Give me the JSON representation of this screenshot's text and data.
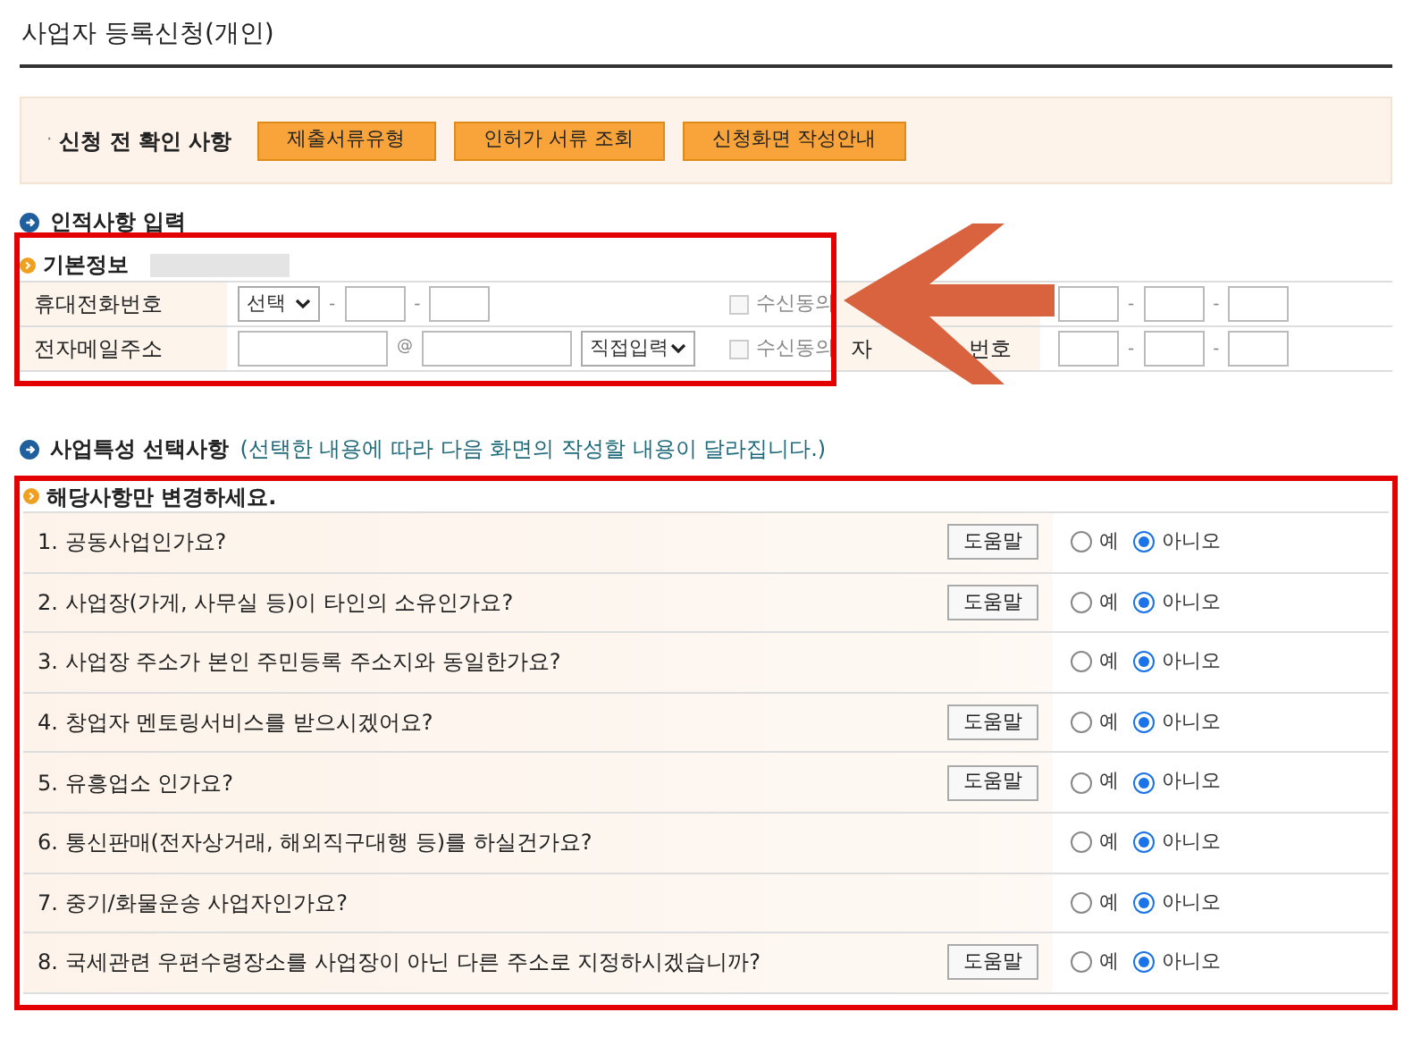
{
  "page_title": "사업자 등록신청(개인)",
  "pre_check": {
    "bullet": "·",
    "label": "신청 전 확인 사항",
    "buttons": [
      "제출서류유형",
      "인허가 서류 조회",
      "신청화면 작성안내"
    ]
  },
  "personal_section": {
    "title": "인적사항 입력",
    "subtitle": "기본정보",
    "separator": "-",
    "rows": [
      {
        "label": "휴대전화번호",
        "kind": "phone",
        "select": "선택",
        "consent": {
          "label": "수신동의",
          "checked": false
        },
        "right_label_parts": []
      },
      {
        "label": "전자메일주소",
        "kind": "email",
        "at": "@",
        "select": "직접입력",
        "consent": {
          "label": "수신동의",
          "checked": false
        },
        "right_label_parts": [
          "자",
          "번호"
        ]
      }
    ]
  },
  "business_section": {
    "title": "사업특성 선택사항",
    "note": "(선택한 내용에 따라 다음 화면의 작성할 내용이 달라집니다.)",
    "subtitle": "해당사항만 변경하세요.",
    "questions": [
      {
        "text": "1. 공동사업인가요?",
        "help": "도움말",
        "options": [
          {
            "label": "예",
            "selected": false
          },
          {
            "label": "아니오",
            "selected": true
          }
        ]
      },
      {
        "text": "2. 사업장(가게, 사무실 등)이 타인의 소유인가요?",
        "help": "도움말",
        "options": [
          {
            "label": "예",
            "selected": false
          },
          {
            "label": "아니오",
            "selected": true
          }
        ]
      },
      {
        "text": "3. 사업장 주소가 본인 주민등록 주소지와 동일한가요?",
        "options": [
          {
            "label": "예",
            "selected": false
          },
          {
            "label": "아니오",
            "selected": true
          }
        ]
      },
      {
        "text": "4. 창업자 멘토링서비스를 받으시겠어요?",
        "help": "도움말",
        "options": [
          {
            "label": "예",
            "selected": false
          },
          {
            "label": "아니오",
            "selected": true
          }
        ]
      },
      {
        "text": "5. 유흥업소 인가요?",
        "help": "도움말",
        "options": [
          {
            "label": "예",
            "selected": false
          },
          {
            "label": "아니오",
            "selected": true
          }
        ]
      },
      {
        "text": "6. 통신판매(전자상거래, 해외직구대행 등)를 하실건가요?",
        "options": [
          {
            "label": "예",
            "selected": false
          },
          {
            "label": "아니오",
            "selected": true
          }
        ]
      },
      {
        "text": "7. 중기/화물운송 사업자인가요?",
        "options": [
          {
            "label": "예",
            "selected": false
          },
          {
            "label": "아니오",
            "selected": true
          }
        ]
      },
      {
        "text": "8. 국세관련 우편수령장소를 사업장이 아닌 다른 주소로 지정하시겠습니까?",
        "help": "도움말",
        "options": [
          {
            "label": "예",
            "selected": false
          },
          {
            "label": "아니오",
            "selected": true
          }
        ]
      }
    ]
  }
}
